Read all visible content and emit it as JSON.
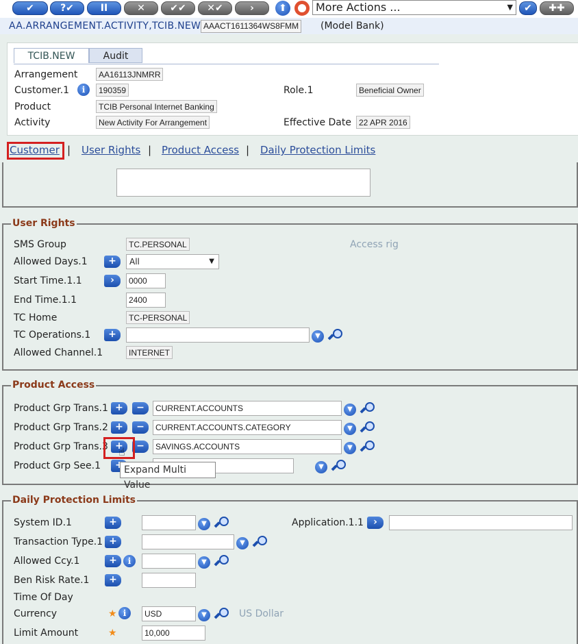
{
  "toolbar": {
    "commit_label": "✔",
    "validate_label": "?✔",
    "hold_label": "II",
    "delete_label": "✕",
    "authorise_label": "✔✔",
    "reverse_label": "✕✔",
    "next_label": "›",
    "more_actions": "More Actions ..."
  },
  "title": {
    "application": "AA.ARRANGEMENT.ACTIVITY,TCIB.NEW",
    "record_id": "AAACT1611364WS8FMM",
    "company": "(Model Bank)"
  },
  "tabs": [
    "TCIB.NEW",
    "Audit"
  ],
  "header": {
    "arrangement_label": "Arrangement",
    "arrangement_value": "AA16113JNMRR",
    "customer_label": "Customer.1",
    "customer_value": "190359",
    "role_label": "Role.1",
    "role_value": "Beneficial Owner",
    "product_label": "Product",
    "product_value": "TCIB Personal Internet Banking",
    "activity_label": "Activity",
    "activity_value": "New Activity For Arrangement",
    "effective_label": "Effective Date",
    "effective_value": "22 APR 2016"
  },
  "links": {
    "customer": "Customer",
    "user_rights": "User Rights",
    "product_access": "Product Access",
    "daily_limits": "Daily Protection Limits",
    "separator": "|"
  },
  "user_rights": {
    "legend": "User Rights",
    "sms_group_label": "SMS Group",
    "sms_group_value": "TC.PERSONAL",
    "access_hint": "Access rig",
    "allowed_days_label": "Allowed Days.1",
    "allowed_days_value": "All",
    "start_time_label": "Start Time.1.1",
    "start_time_value": "0000",
    "end_time_label": "End Time.1.1",
    "end_time_value": "2400",
    "tc_home_label": "TC Home",
    "tc_home_value": "TC-PERSONAL",
    "tc_operations_label": "TC Operations.1",
    "tc_operations_value": "",
    "allowed_channel_label": "Allowed Channel.1",
    "allowed_channel_value": "INTERNET"
  },
  "product_access": {
    "legend": "Product Access",
    "rows": [
      {
        "label": "Product Grp Trans.1",
        "value": "CURRENT.ACCOUNTS"
      },
      {
        "label": "Product Grp Trans.2",
        "value": "CURRENT.ACCOUNTS.CATEGORY"
      },
      {
        "label": "Product Grp Trans.3",
        "value": "SAVINGS.ACCOUNTS"
      }
    ],
    "see_label": "Product Grp See.1",
    "tooltip": "Expand Multi Value"
  },
  "daily_limits": {
    "legend": "Daily Protection Limits",
    "system_id_label": "System ID.1",
    "application_label": "Application.1.1",
    "transaction_type_label": "Transaction Type.1",
    "allowed_ccy_label": "Allowed Ccy.1",
    "ben_risk_label": "Ben Risk Rate.1",
    "time_of_day_label": "Time Of Day",
    "currency_label": "Currency",
    "currency_value": "USD",
    "currency_desc": "US Dollar",
    "limit_amount_label": "Limit Amount",
    "limit_amount_value": "10,000"
  },
  "colors": {
    "button_blue": "#1f55b8",
    "legend_brown": "#8b3a1a",
    "link_blue": "#2b4d9a",
    "highlight_red": "#d42020",
    "mandatory_orange": "#f28c1a"
  }
}
